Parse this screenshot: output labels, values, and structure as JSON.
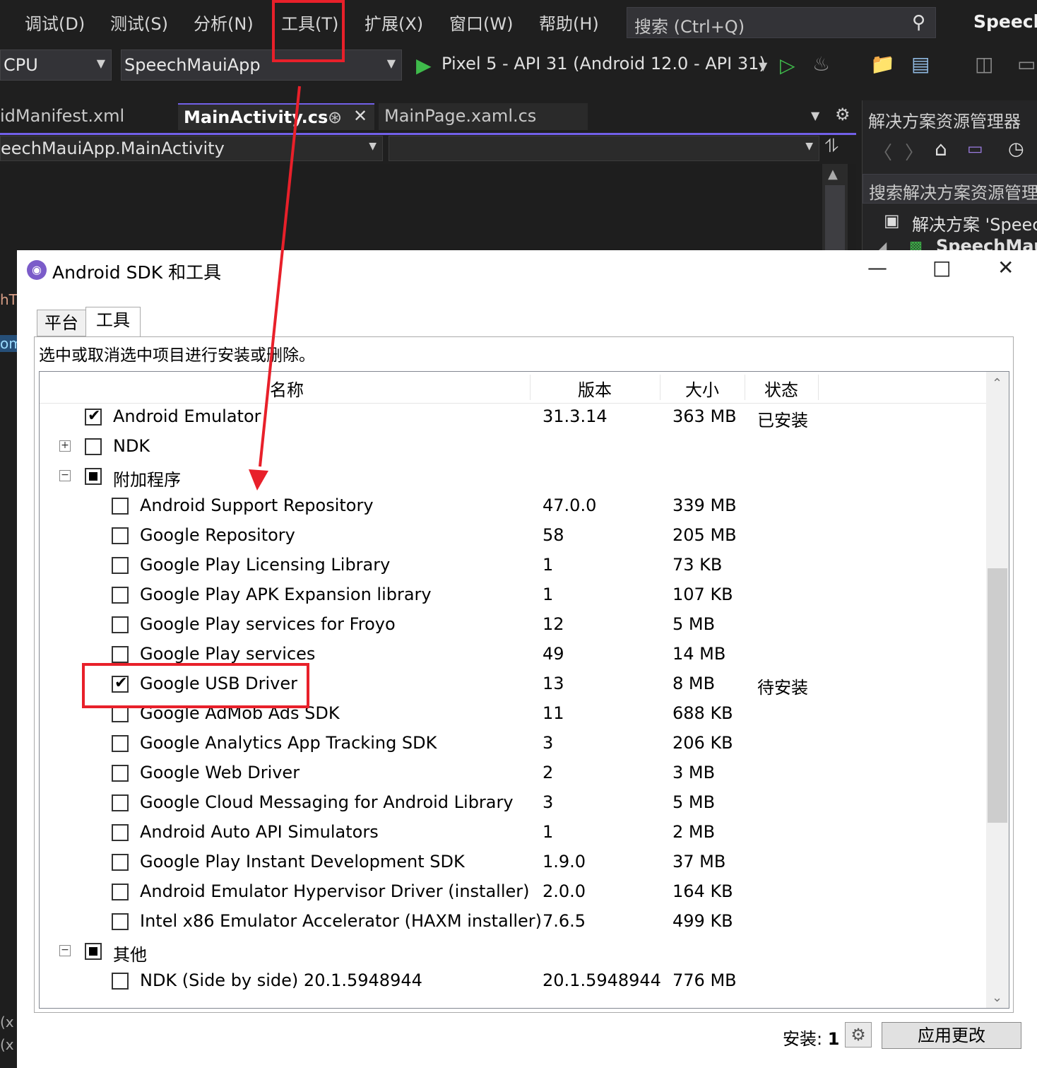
{
  "menubar": {
    "items": [
      "调试(D)",
      "测试(S)",
      "分析(N)",
      "工具(T)",
      "扩展(X)",
      "窗口(W)",
      "帮助(H)"
    ],
    "search_label": "搜索 (Ctrl+Q)",
    "brand": "Speech/"
  },
  "toolbar": {
    "platform": "CPU",
    "project": "SpeechMauiApp",
    "device": "Pixel 5 - API 31 (Android 12.0 - API 31)"
  },
  "doc_tabs": [
    "idManifest.xml",
    "MainActivity.cs",
    "MainPage.xaml.cs"
  ],
  "nav": {
    "type_path": "eechMauiApp.MainActivity"
  },
  "solution_explorer": {
    "title": "解决方案资源管理器",
    "search": "搜索解决方案资源管理",
    "solution_node": "解决方案 'Speec",
    "project_node": "SpeechMau"
  },
  "left_fragments": [
    "hT",
    "om",
    "(x",
    "(x"
  ],
  "dialog": {
    "title": "Android SDK 和工具",
    "tabs": [
      "平台",
      "工具"
    ],
    "active_tab": "工具",
    "instruction": "选中或取消选中项目进行安装或删除。",
    "columns": [
      "名称",
      "版本",
      "大小",
      "状态"
    ],
    "rows": [
      {
        "name": "Android Emulator",
        "version": "31.3.14",
        "size": "363 MB",
        "status": "已安装",
        "checked": "checked",
        "level": 0,
        "expander": ""
      },
      {
        "name": "NDK",
        "version": "",
        "size": "",
        "status": "",
        "checked": "unchecked",
        "level": 0,
        "expander": "+"
      },
      {
        "name": "附加程序",
        "version": "",
        "size": "",
        "status": "",
        "checked": "partial",
        "level": 0,
        "expander": "−"
      },
      {
        "name": "Android Support Repository",
        "version": "47.0.0",
        "size": "339 MB",
        "status": "",
        "checked": "unchecked",
        "level": 1,
        "expander": ""
      },
      {
        "name": "Google Repository",
        "version": "58",
        "size": "205 MB",
        "status": "",
        "checked": "unchecked",
        "level": 1,
        "expander": ""
      },
      {
        "name": "Google Play Licensing Library",
        "version": "1",
        "size": "73 KB",
        "status": "",
        "checked": "unchecked",
        "level": 1,
        "expander": ""
      },
      {
        "name": "Google Play APK Expansion library",
        "version": "1",
        "size": "107 KB",
        "status": "",
        "checked": "unchecked",
        "level": 1,
        "expander": ""
      },
      {
        "name": "Google Play services for Froyo",
        "version": "12",
        "size": "5 MB",
        "status": "",
        "checked": "unchecked",
        "level": 1,
        "expander": ""
      },
      {
        "name": "Google Play services",
        "version": "49",
        "size": "14 MB",
        "status": "",
        "checked": "unchecked",
        "level": 1,
        "expander": ""
      },
      {
        "name": "Google USB Driver",
        "version": "13",
        "size": "8 MB",
        "status": "待安装",
        "checked": "checked",
        "level": 1,
        "expander": ""
      },
      {
        "name": "Google AdMob Ads SDK",
        "version": "11",
        "size": "688 KB",
        "status": "",
        "checked": "unchecked",
        "level": 1,
        "expander": ""
      },
      {
        "name": "Google Analytics App Tracking SDK",
        "version": "3",
        "size": "206 KB",
        "status": "",
        "checked": "unchecked",
        "level": 1,
        "expander": ""
      },
      {
        "name": "Google Web Driver",
        "version": "2",
        "size": "3 MB",
        "status": "",
        "checked": "unchecked",
        "level": 1,
        "expander": ""
      },
      {
        "name": "Google Cloud Messaging for Android Library",
        "version": "3",
        "size": "5 MB",
        "status": "",
        "checked": "unchecked",
        "level": 1,
        "expander": ""
      },
      {
        "name": "Android Auto API Simulators",
        "version": "1",
        "size": "2 MB",
        "status": "",
        "checked": "unchecked",
        "level": 1,
        "expander": ""
      },
      {
        "name": "Google Play Instant Development SDK",
        "version": "1.9.0",
        "size": "37 MB",
        "status": "",
        "checked": "unchecked",
        "level": 1,
        "expander": ""
      },
      {
        "name": "Android Emulator Hypervisor Driver (installer)",
        "version": "2.0.0",
        "size": "164 KB",
        "status": "",
        "checked": "unchecked",
        "level": 1,
        "expander": ""
      },
      {
        "name": "Intel x86 Emulator Accelerator (HAXM installer)",
        "version": "7.6.5",
        "size": "499 KB",
        "status": "",
        "checked": "unchecked",
        "level": 1,
        "expander": ""
      },
      {
        "name": "其他",
        "version": "",
        "size": "",
        "status": "",
        "checked": "partial",
        "level": 0,
        "expander": "−"
      },
      {
        "name": "NDK (Side by side) 20.1.5948944",
        "version": "20.1.5948944",
        "size": "776 MB",
        "status": "",
        "checked": "unchecked",
        "level": 1,
        "expander": ""
      }
    ],
    "install_label": "安装:",
    "install_count": "1",
    "apply_label": "应用更改"
  },
  "colors": {
    "annotation": "#e8202a",
    "accent": "#7160e8",
    "run_green": "#3fba4b"
  }
}
